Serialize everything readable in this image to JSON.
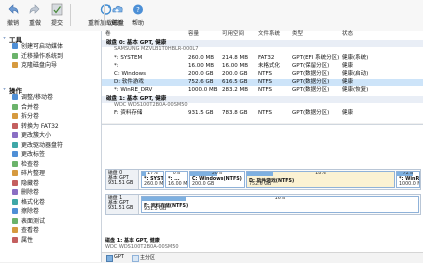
{
  "toolbar": {
    "buttons": [
      {
        "label": "撤销",
        "icon": "undo-icon"
      },
      {
        "label": "重做",
        "icon": "redo-icon"
      },
      {
        "label": "提交",
        "icon": "apply-icon"
      },
      {
        "label": "重新加载磁盘",
        "icon": "reload-disk-icon"
      },
      {
        "label": "更新",
        "icon": "update-icon"
      },
      {
        "label": "帮助",
        "icon": "help-icon"
      }
    ]
  },
  "sidebar": {
    "tools_title": "工具",
    "tools": [
      "创建可启动媒体",
      "迁移操作系统到",
      "克隆磁盘向导"
    ],
    "ops_title": "操作",
    "ops": [
      "调整/移动卷",
      "合并卷",
      "拆分卷",
      "转换为 FAT32",
      "更改簇大小",
      "更改驱动器盘符",
      "更改标签",
      "检查卷",
      "碎片整理",
      "隐藏卷",
      "删除卷",
      "格式化卷",
      "擦除卷",
      "表面测试",
      "查看卷",
      "属性"
    ]
  },
  "columns": [
    "卷",
    "容量",
    "可用空间",
    "文件系统",
    "类型",
    "状态"
  ],
  "list": {
    "disk0": {
      "title": "磁盘 0: 基本 GPT, 健康",
      "model": "SAMSUNG MZVLB1T0HBLR-000L7"
    },
    "vols0": [
      {
        "name": "*: SYSTEM",
        "cap": "260.0 MB",
        "free": "214.8 MB",
        "fs": "FAT32",
        "type": "GPT(EFI 系统分区)",
        "status": "健康(系统)"
      },
      {
        "name": "*:",
        "cap": "16.00 MB",
        "free": "16.00 MB",
        "fs": "未格式化",
        "type": "GPT(保留分区)",
        "status": "健康"
      },
      {
        "name": "C: Windows",
        "cap": "200.0 GB",
        "free": "200.0 GB",
        "fs": "NTFS",
        "type": "GPT(数据分区)",
        "status": "健康(启动)"
      },
      {
        "name": "D: 软件游戏",
        "cap": "752.6 GB",
        "free": "616.5 GB",
        "fs": "NTFS",
        "type": "GPT(数据分区)",
        "status": "健康"
      },
      {
        "name": "*: WinRE_DRV",
        "cap": "1000.0 MB",
        "free": "283.2 MB",
        "fs": "NTFS",
        "type": "GPT(数据分区)",
        "status": "健康(恢复)"
      }
    ],
    "disk1": {
      "title": "磁盘 1: 基本 GPT, 健康",
      "model": "WDC WDS100T2B0A-00SM50"
    },
    "vols1": [
      {
        "name": "F: 资料存储",
        "cap": "931.5 GB",
        "free": "783.8 GB",
        "fs": "NTFS",
        "type": "GPT(数据分区)",
        "status": "健康"
      }
    ]
  },
  "diskmap": {
    "d0": {
      "label": "磁盘 0",
      "kind": "基本 GPT",
      "size": "931.51 GB"
    },
    "d0parts": [
      {
        "pct": "17%",
        "name": "*: SYST...",
        "size": "260.0 MB",
        "fill": 0.17
      },
      {
        "pct": "0%",
        "name": "*: ...",
        "size": "16.00 MB",
        "fill": 0
      },
      {
        "pct": "50%",
        "name": "C: Windows(NTFS)",
        "size": "200.0 GB",
        "fill": 0.5
      },
      {
        "pct": "18%",
        "name": "D: 软件游戏(NTFS)",
        "size": "752.6 GB",
        "fill": 0.18
      },
      {
        "pct": "72%",
        "name": "*: WinR...",
        "size": "1000.0 MB",
        "fill": 0.72
      }
    ],
    "d1": {
      "label": "磁盘 1",
      "kind": "基本 GPT",
      "size": "931.51 GB"
    },
    "d1parts": [
      {
        "pct": "16%",
        "name": "F: 资料存储(NTFS)",
        "size": "931.5 GB",
        "fill": 0.16
      }
    ],
    "status_row": {
      "title": "磁盘 1: 基本 GPT, 健康",
      "sub": "WDC WDS100T2B0A-00SM50"
    }
  },
  "statusbar": {
    "legend1": "GPT",
    "legend2": "主分区"
  },
  "colors": {
    "accent": "#2b5aa0",
    "selected": "#cde4f9",
    "bar": "#7eb0e0",
    "diskrow": "#e9eef6"
  }
}
